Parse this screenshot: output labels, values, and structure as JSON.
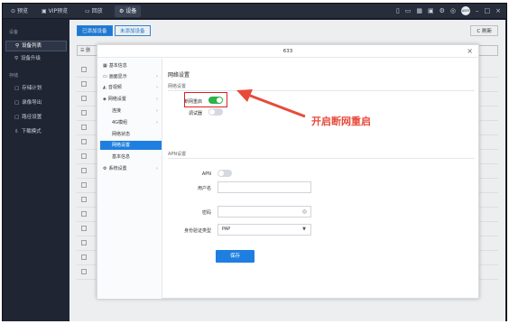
{
  "topbar": {
    "tabs": [
      {
        "icon": "⊙",
        "label": "预览"
      },
      {
        "icon": "▣",
        "label": "VIP预览"
      },
      {
        "icon": "▭",
        "label": "回放"
      },
      {
        "icon": "⚙",
        "label": "设备"
      }
    ],
    "icons": [
      "lock-icon",
      "folder-icon",
      "grid-icon",
      "image-icon",
      "settings-icon",
      "account-icon",
      "user-avatar-icon",
      "minimize-icon",
      "maximize-icon",
      "close-icon"
    ],
    "avatar_text": "user"
  },
  "sidebar": {
    "section1": "设备",
    "items1": [
      {
        "icon": "⚲",
        "label": "设备列表"
      },
      {
        "icon": "⚲",
        "label": "设备升级"
      }
    ],
    "section2": "存储",
    "items2": [
      {
        "icon": "▢",
        "label": "存储计划"
      },
      {
        "icon": "▢",
        "label": "录像导出"
      },
      {
        "icon": "▢",
        "label": "路径设置"
      },
      {
        "icon": "⇩",
        "label": "下载模式"
      }
    ]
  },
  "main": {
    "tab_added": "已添加设备",
    "tab_not_added": "未添加设备",
    "refresh": "C 刷新",
    "search_stub": "☰ 删"
  },
  "modal": {
    "title": "633",
    "close": "×",
    "nav": [
      {
        "icon": "▦",
        "label": "基本信息",
        "chev": ""
      },
      {
        "icon": "▭",
        "label": "画面显示",
        "chev": "›"
      },
      {
        "icon": "◭",
        "label": "音视频",
        "chev": "›"
      },
      {
        "icon": "◈",
        "label": "网络设置",
        "chev": "›"
      },
      {
        "icon": "",
        "label": "连接",
        "chev": "›"
      },
      {
        "icon": "",
        "label": "4G模组",
        "chev": "›"
      },
      {
        "icon": "",
        "label": "网络状态",
        "chev": ""
      },
      {
        "icon": "",
        "label": "网络设置",
        "chev": ""
      },
      {
        "icon": "",
        "label": "基本信息",
        "chev": ""
      },
      {
        "icon": "⚙",
        "label": "系统设置",
        "chev": "›"
      }
    ],
    "content_title": "网络设置",
    "section_network": "网络设置",
    "reconnect_label": "断网重启",
    "reconnect_on": true,
    "debugger_label": "调试器",
    "debugger_on": false,
    "section_apn": "APN设置",
    "apn_label": "APN",
    "apn_on": false,
    "username_label": "用户名",
    "username_value": "",
    "password_label": "密码",
    "password_value": "",
    "auth_label": "身份验证类型",
    "auth_value": "PAP",
    "save": "保存"
  },
  "annotation": "开启断网重启"
}
